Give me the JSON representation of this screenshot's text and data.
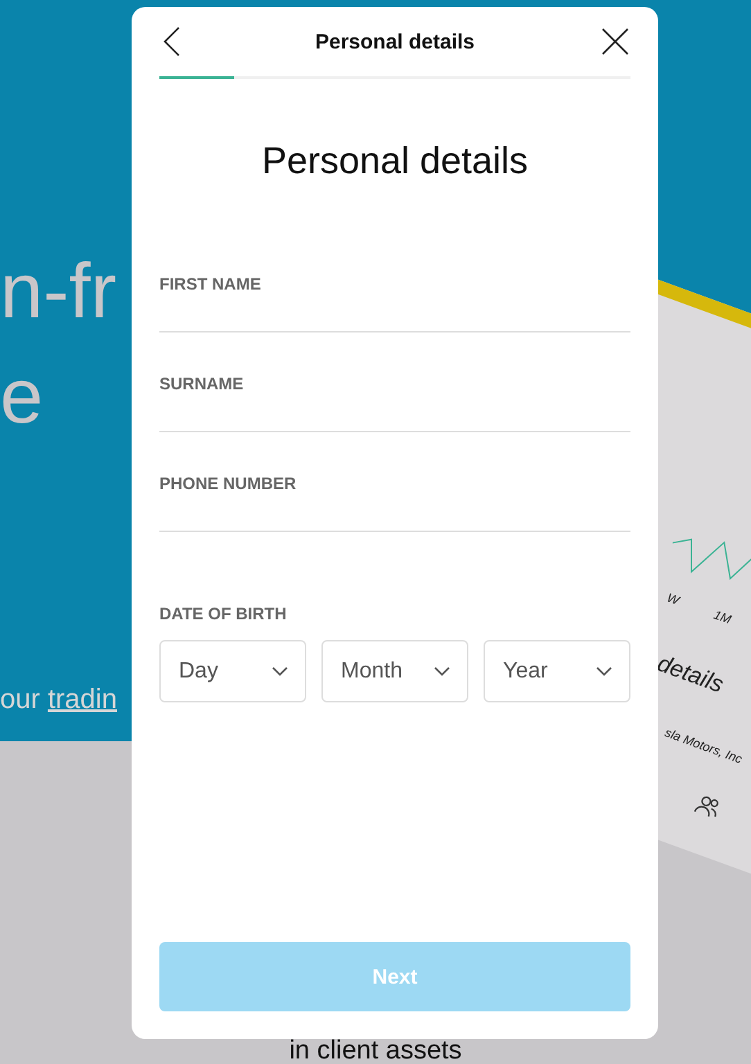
{
  "background": {
    "headline_lines": [
      "n-fr",
      "e"
    ],
    "subtitle": {
      "text": "our ",
      "link": "tradin"
    },
    "device": {
      "tabs": [
        "W",
        "1M"
      ],
      "heading": "details",
      "company": "sla Motors, Inc"
    },
    "footer_text": "in client assets"
  },
  "dialog": {
    "title": "Personal details",
    "progress": {
      "level": 0.16
    },
    "heading": "Personal details",
    "fields": [
      {
        "label": "FIRST NAME"
      },
      {
        "label": "SURNAME"
      },
      {
        "label": "PHONE NUMBER"
      }
    ],
    "date_of_birth": {
      "label": "DATE OF BIRTH",
      "selects": [
        {
          "placeholder": "Day"
        },
        {
          "placeholder": "Month"
        },
        {
          "placeholder": "Year"
        }
      ]
    },
    "next_button": {
      "label": "Next",
      "disabled": true
    }
  }
}
